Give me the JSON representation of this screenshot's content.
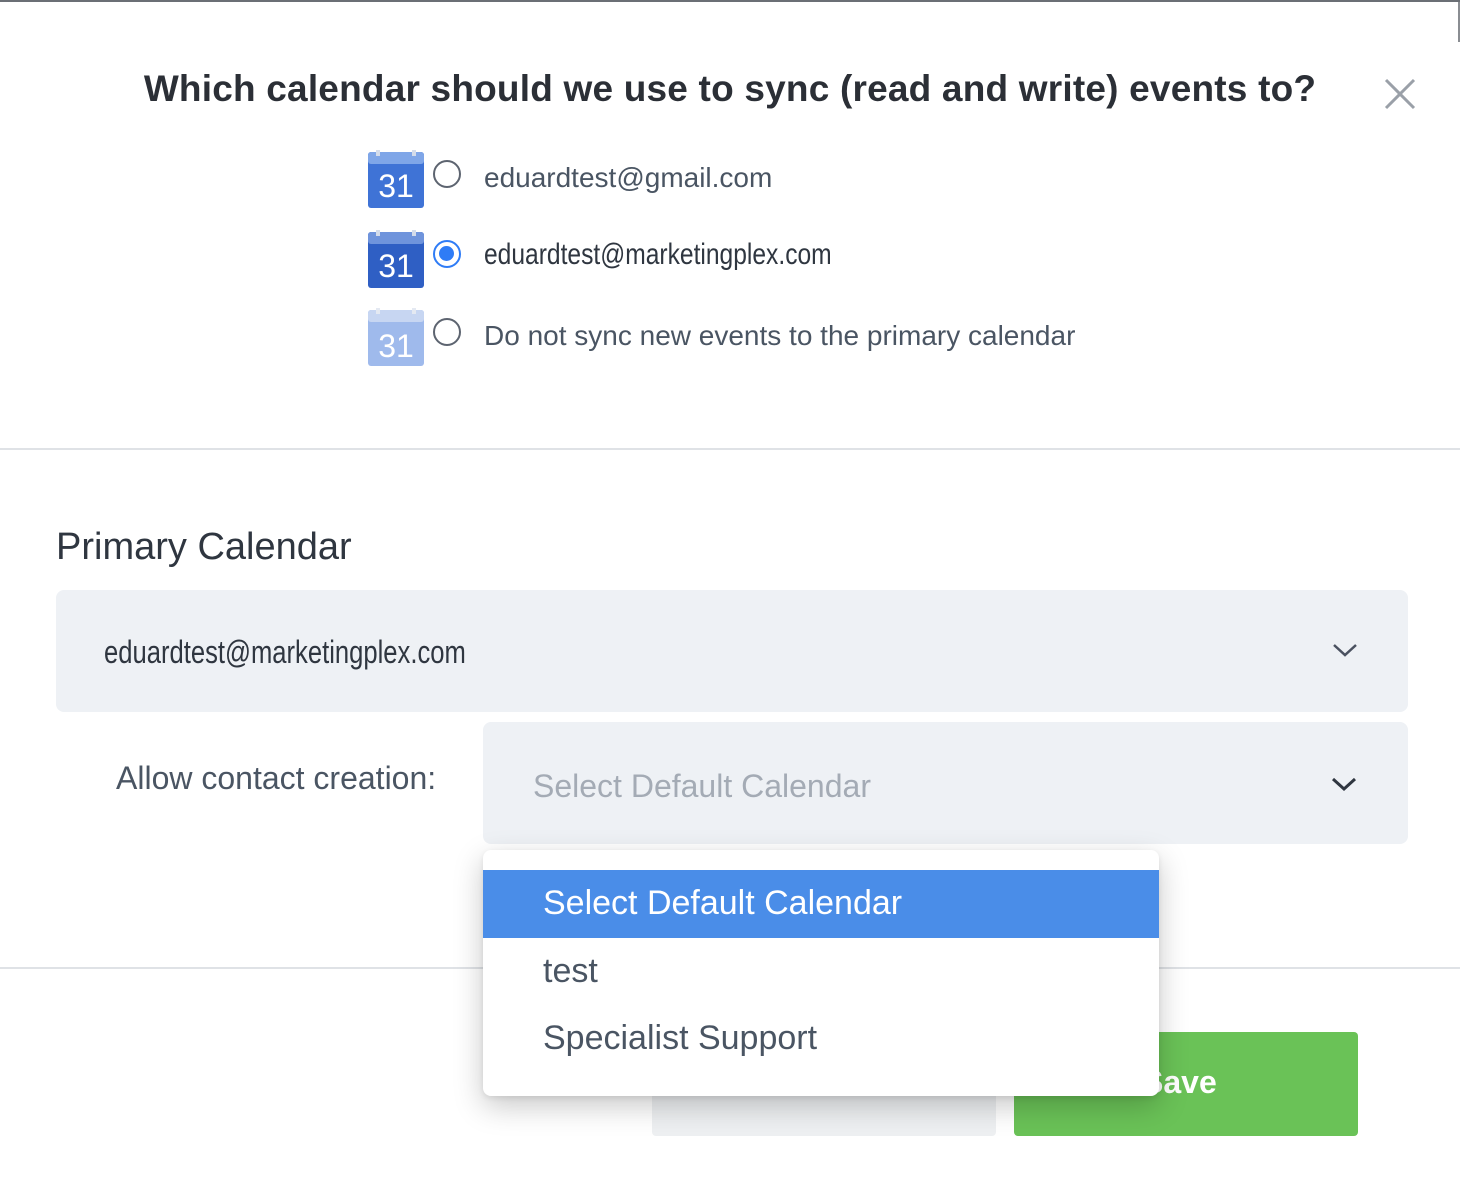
{
  "dialog": {
    "title": "Which calendar should we use to sync (read and write) events to?",
    "close_icon": "close-icon"
  },
  "sync_options": [
    {
      "label": "eduardtest@gmail.com",
      "checked": false,
      "icon_text": "31"
    },
    {
      "label": "eduardtest@marketingplex.com",
      "checked": true,
      "icon_text": "31"
    },
    {
      "label": "Do not sync new events to the primary calendar",
      "checked": false,
      "icon_text": "31"
    }
  ],
  "primary_calendar": {
    "title": "Primary Calendar",
    "selected_value": "eduardtest@marketingplex.com"
  },
  "contact_creation": {
    "label": "Allow contact creation:",
    "placeholder": "Select Default Calendar",
    "options": [
      "Select Default Calendar",
      "test",
      "Specialist Support"
    ],
    "highlighted_option": "Select Default Calendar"
  },
  "buttons": {
    "save_label": "Save"
  },
  "colors": {
    "accent": "#2f7cf6",
    "highlight": "#4a8de8",
    "save": "#6ac257",
    "field_bg": "#eef1f5"
  }
}
